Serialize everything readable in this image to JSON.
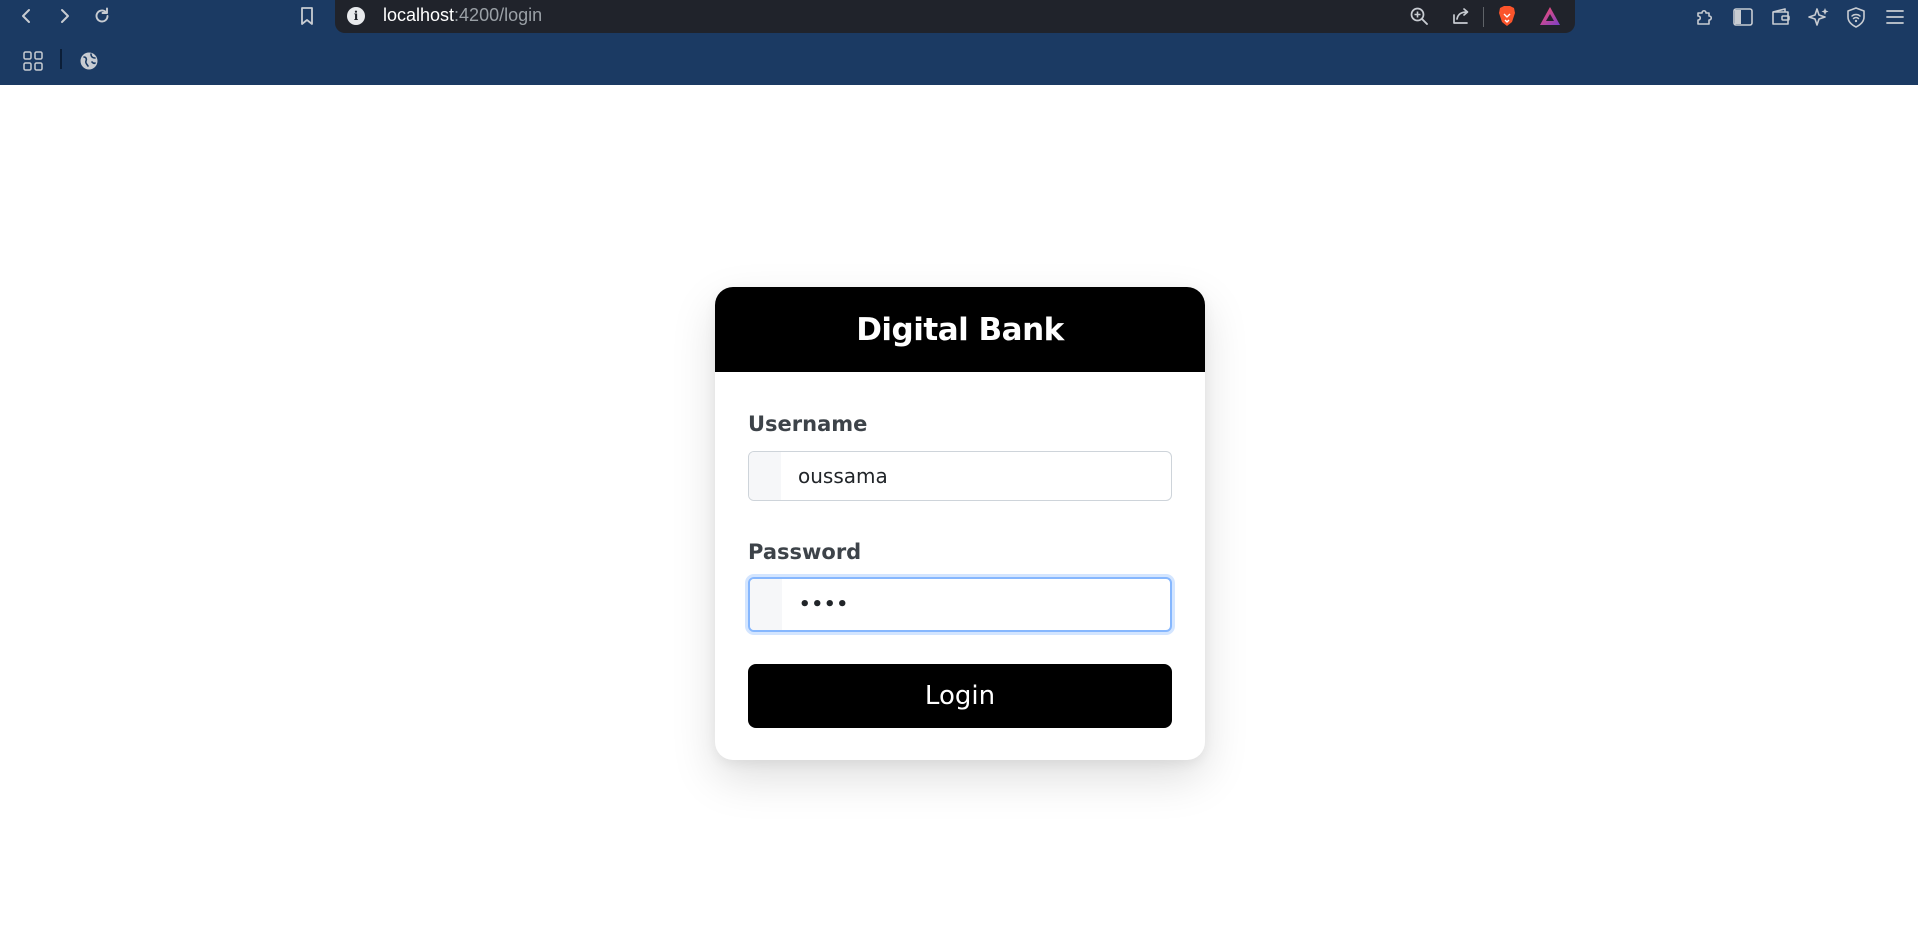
{
  "browser": {
    "url_host": "localhost",
    "url_path": ":4200/login",
    "icons": {
      "back": "back-arrow-icon",
      "forward": "forward-arrow-icon",
      "reload": "reload-icon",
      "bookmark": "bookmark-icon",
      "site_info": "info-icon",
      "zoom": "zoom-in-icon",
      "share": "share-icon",
      "brave_shields": "brave-lion-icon",
      "brave_rewards": "rewards-triangle-icon",
      "extensions": "puzzle-icon",
      "sidebar": "sidebar-icon",
      "wallet": "wallet-icon",
      "leo": "sparkle-icon",
      "vpn": "vpn-shield-icon",
      "menu": "menu-icon",
      "apps": "apps-grid-icon",
      "globe": "globe-icon"
    },
    "colors": {
      "chrome_bg": "#1b3a63",
      "urlbar_bg": "#20232b"
    }
  },
  "login": {
    "title": "Digital Bank",
    "username_label": "Username",
    "username_value": "oussama",
    "password_label": "Password",
    "password_value": "••••",
    "submit_label": "Login"
  }
}
